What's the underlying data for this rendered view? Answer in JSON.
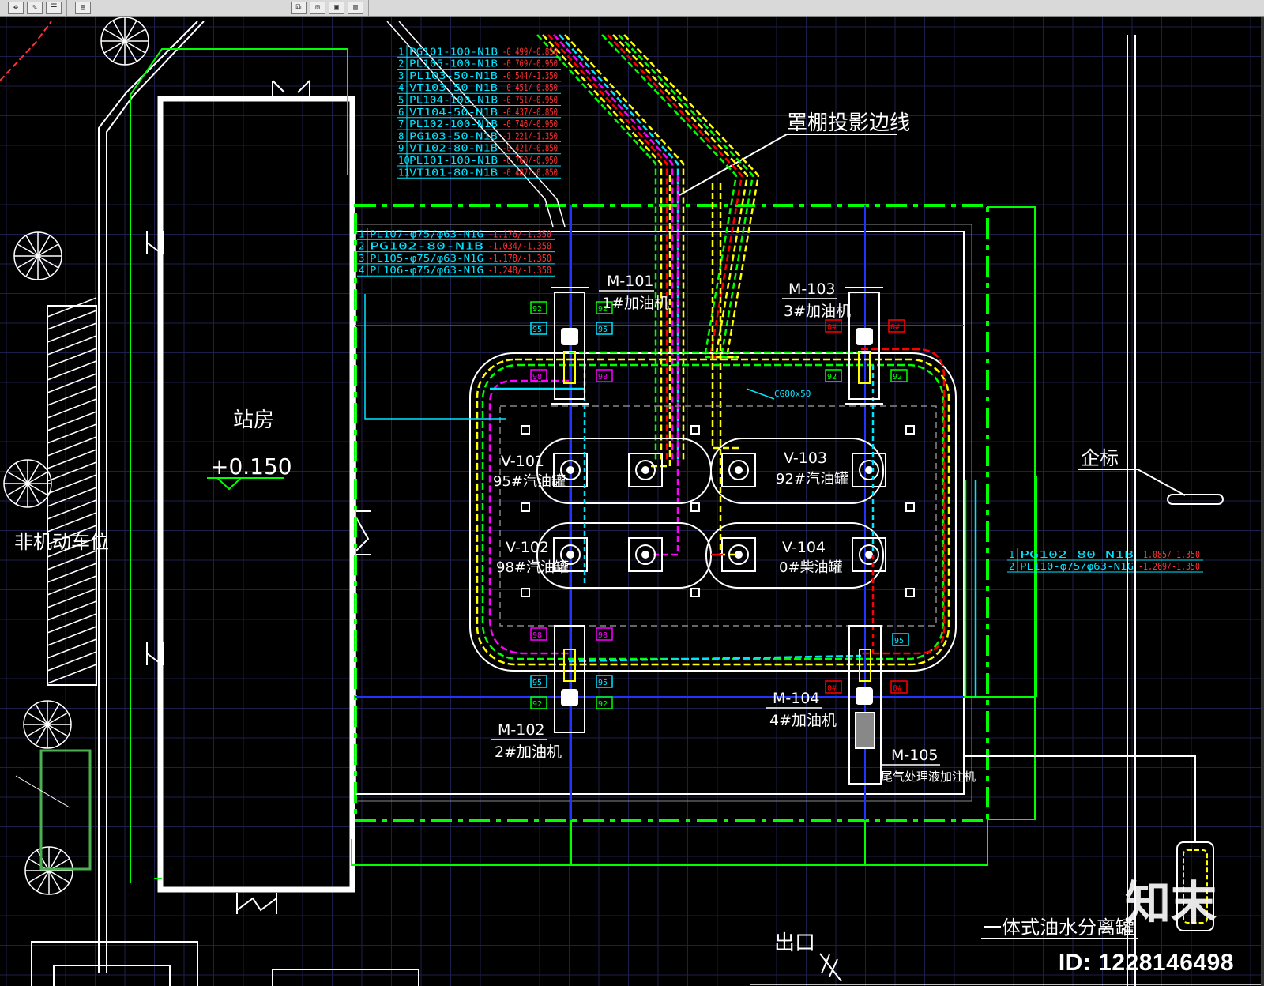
{
  "toolbar": {
    "buttons": [
      "pan-icon",
      "edit-icon",
      "layers-icon",
      "props-icon",
      "copy-icon",
      "paste-icon",
      "block-icon",
      "save-icon"
    ]
  },
  "colors": {
    "background": "#000000",
    "grid": "#1e1e4a",
    "white": "#ffffff",
    "green": "#00ff00",
    "yellow": "#ffff00",
    "magenta": "#ff00ff",
    "cyan": "#00e5ff",
    "red": "#ff0000",
    "blue": "#2233ff"
  },
  "labels": {
    "station_house": "站房",
    "elevation": "+0.150",
    "bike_parking": "非机动车位",
    "canopy_line": "罩棚投影边线",
    "enterprise_sign": "企标",
    "separator_tank": "一体式油水分离罐",
    "exit": "出口"
  },
  "dispensers": {
    "m101": {
      "code": "M-101",
      "name": "1#加油机"
    },
    "m102": {
      "code": "M-102",
      "name": "2#加油机"
    },
    "m103": {
      "code": "M-103",
      "name": "3#加油机"
    },
    "m104": {
      "code": "M-104",
      "name": "4#加油机"
    },
    "m105": {
      "code": "M-105",
      "name": "尾气处理液加注机"
    }
  },
  "tanks": {
    "v101": {
      "code": "V-101",
      "name": "95#汽油罐"
    },
    "v102": {
      "code": "V-102",
      "name": "98#汽油罐"
    },
    "v103": {
      "code": "V-103",
      "name": "92#汽油罐"
    },
    "v104": {
      "code": "V-104",
      "name": "0#柴油罐"
    }
  },
  "pipe_label": "CG80x50",
  "tables": {
    "top": [
      {
        "n": "1",
        "code": "PG101-100-N1B",
        "elev": "-0.499/-0.850"
      },
      {
        "n": "2",
        "code": "PL105-100-N1B",
        "elev": "-0.769/-0.950"
      },
      {
        "n": "3",
        "code": "PL103-50-N1B",
        "elev": "-0.544/-1.350"
      },
      {
        "n": "4",
        "code": "VT103-50-N1B",
        "elev": "-0.451/-0.850"
      },
      {
        "n": "5",
        "code": "PL104-100-N1B",
        "elev": "-0.751/-0.950"
      },
      {
        "n": "6",
        "code": "VT104-50-N1B",
        "elev": "-0.437/-0.850"
      },
      {
        "n": "7",
        "code": "PL102-100-N1B",
        "elev": "-0.746/-0.950"
      },
      {
        "n": "8",
        "code": "PG103-50-N1B",
        "elev": "-1.221/-1.350"
      },
      {
        "n": "9",
        "code": "VT102-80-N1B",
        "elev": "-0.421/-0.850"
      },
      {
        "n": "10",
        "code": "PL101-100-N1B",
        "elev": "-0.760/-0.950"
      },
      {
        "n": "11",
        "code": "VT101-80-N1B",
        "elev": "-0.487/-0.850"
      }
    ],
    "mid": [
      {
        "n": "1",
        "code": "PL107-φ75/φ63-N1G",
        "elev": "-1.176/-1.350"
      },
      {
        "n": "2",
        "code": "PG102-80-N1B",
        "elev": "-1.034/-1.350"
      },
      {
        "n": "3",
        "code": "PL105-φ75/φ63-N1G",
        "elev": "-1.178/-1.350"
      },
      {
        "n": "4",
        "code": "PL106-φ75/φ63-N1G",
        "elev": "-1.248/-1.350"
      }
    ],
    "right": [
      {
        "n": "1",
        "code": "PG102-80-N1B",
        "elev": "-1.085/-1.350"
      },
      {
        "n": "2",
        "code": "PL110-φ75/φ63-N1G",
        "elev": "-1.269/-1.350"
      }
    ]
  },
  "tags": {
    "t92": "92",
    "t95": "95",
    "t98": "98",
    "t0": "0#"
  },
  "watermark": {
    "logo": "知末",
    "id": "ID: 1228146498"
  }
}
